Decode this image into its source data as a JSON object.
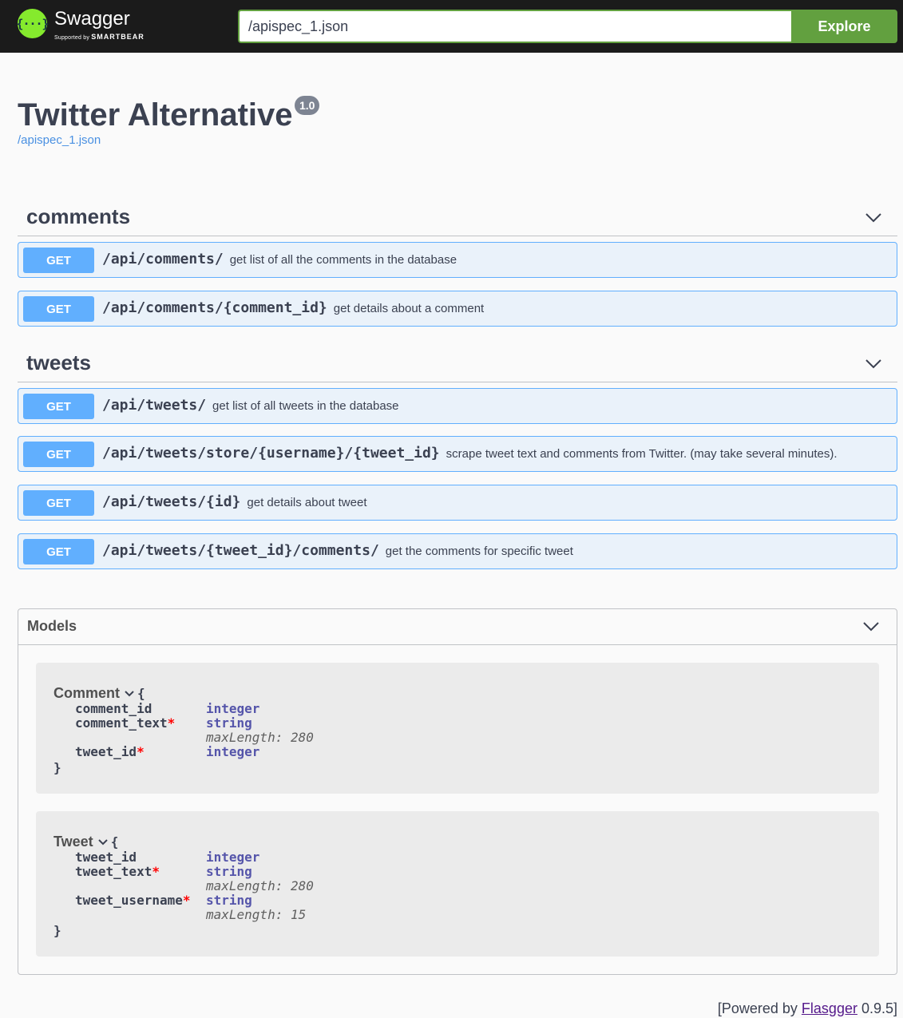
{
  "topbar": {
    "logo_name": "Swagger",
    "logo_sub_prefix": "Supported by",
    "logo_sub_brand": "SMARTBEAR",
    "url_value": "/apispec_1.json",
    "explore_label": "Explore"
  },
  "info": {
    "title": "Twitter Alternative",
    "version": "1.0",
    "spec_url": "/apispec_1.json"
  },
  "tags": [
    {
      "name": "comments",
      "operations": [
        {
          "method": "GET",
          "path": "/api/comments/",
          "summary": "get list of all the comments in the database"
        },
        {
          "method": "GET",
          "path": "/api/comments/{comment_id}",
          "summary": "get details about a comment"
        }
      ]
    },
    {
      "name": "tweets",
      "operations": [
        {
          "method": "GET",
          "path": "/api/tweets/",
          "summary": "get list of all tweets in the database"
        },
        {
          "method": "GET",
          "path": "/api/tweets/store/{username}/{tweet_id}",
          "summary": "scrape tweet text and comments from Twitter. (may take several minutes)."
        },
        {
          "method": "GET",
          "path": "/api/tweets/{id}",
          "summary": "get details about tweet"
        },
        {
          "method": "GET",
          "path": "/api/tweets/{tweet_id}/comments/",
          "summary": "get the comments for specific tweet"
        }
      ]
    }
  ],
  "models": {
    "title": "Models",
    "items": [
      {
        "name": "Comment",
        "open_brace": "{",
        "close_brace": "}",
        "props": [
          {
            "name": "comment_id",
            "required": "",
            "type": "integer",
            "extra": ""
          },
          {
            "name": "comment_text",
            "required": "*",
            "type": "string",
            "extra": "maxLength: 280"
          },
          {
            "name": "tweet_id",
            "required": "*",
            "type": "integer",
            "extra": ""
          }
        ]
      },
      {
        "name": "Tweet",
        "open_brace": "{",
        "close_brace": "}",
        "props": [
          {
            "name": "tweet_id",
            "required": "",
            "type": "integer",
            "extra": ""
          },
          {
            "name": "tweet_text",
            "required": "*",
            "type": "string",
            "extra": "maxLength: 280"
          },
          {
            "name": "tweet_username",
            "required": "*",
            "type": "string",
            "extra": "maxLength: 15"
          }
        ]
      }
    ]
  },
  "footer": {
    "prefix": "[Powered by ",
    "link": "Flasgger",
    "suffix": " 0.9.5]"
  },
  "colors": {
    "get": "#61afe6",
    "explore": "#62a03f",
    "logo": "#85ea2d"
  }
}
